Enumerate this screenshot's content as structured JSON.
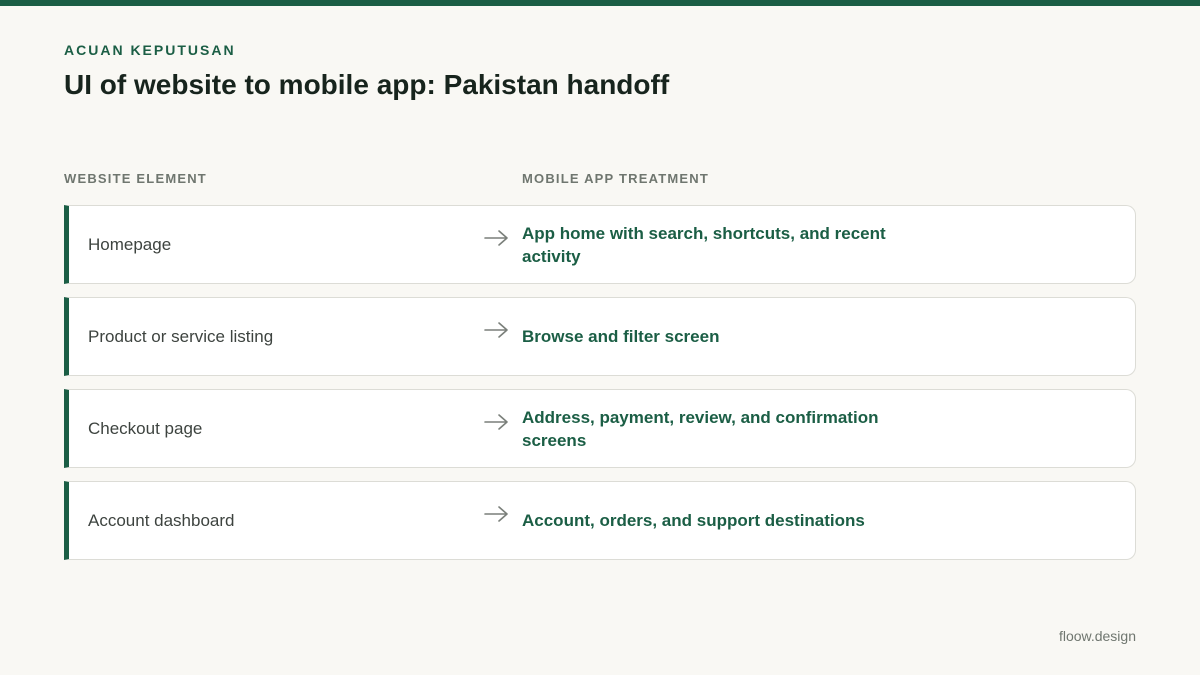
{
  "eyebrow": "ACUAN KEPUTUSAN",
  "title": "UI of website to mobile app: Pakistan handoff",
  "columns": {
    "left": "WEBSITE ELEMENT",
    "right": "MOBILE APP TREATMENT"
  },
  "rows": [
    {
      "element": "Homepage",
      "treatment": "App home with search, shortcuts, and recent activity"
    },
    {
      "element": "Product or service listing",
      "treatment": "Browse and filter screen"
    },
    {
      "element": "Checkout page",
      "treatment": "Address, payment, review, and confirmation screens"
    },
    {
      "element": "Account dashboard",
      "treatment": "Account, orders, and support destinations"
    }
  ],
  "icons": {
    "row_arrow": "arrow-right-icon"
  },
  "colors": {
    "accent": "#1b5e45",
    "background": "#f9f8f4",
    "muted": "#6f766f",
    "card": "#ffffff"
  },
  "footer": "floow.design"
}
